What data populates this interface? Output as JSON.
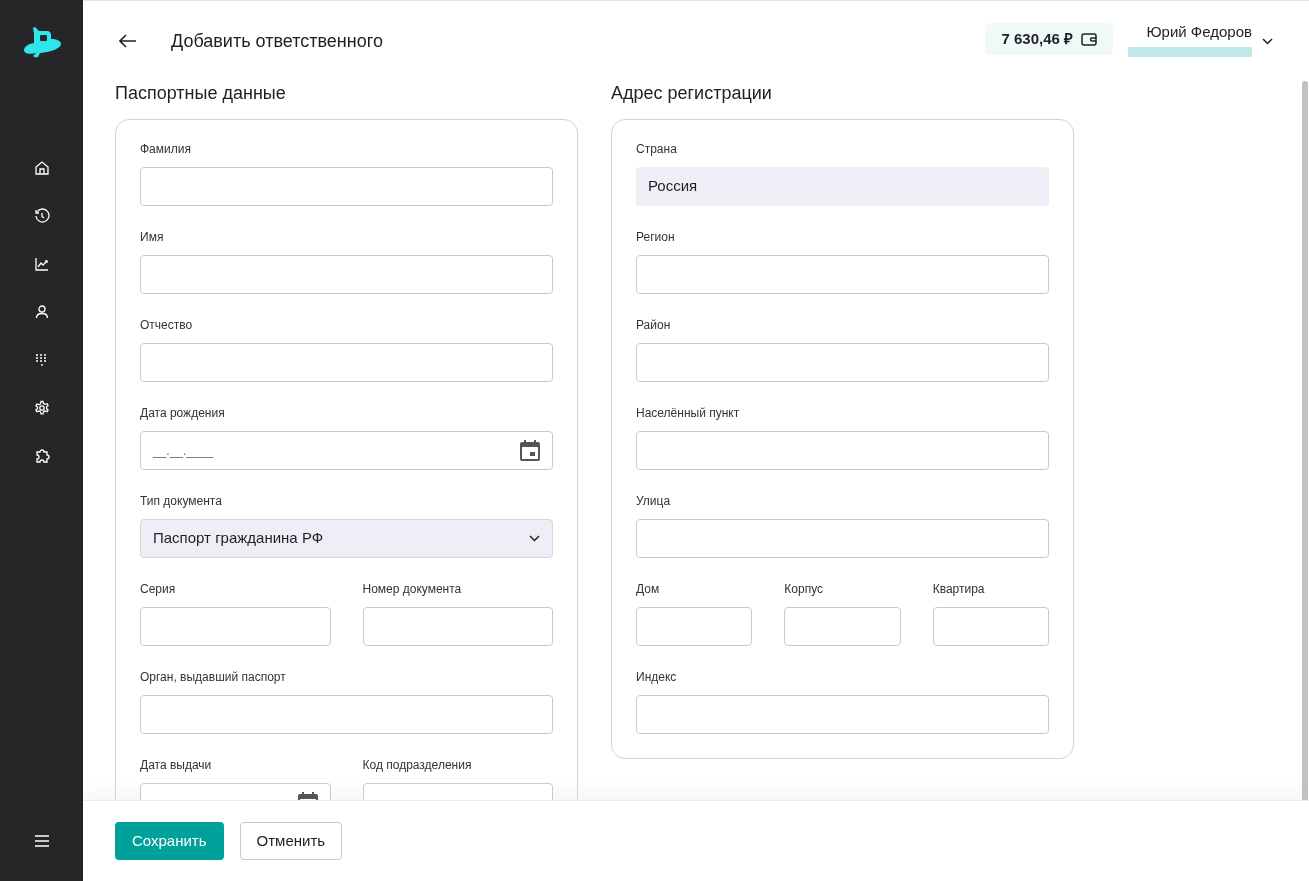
{
  "header": {
    "title": "Добавить ответственного",
    "balance": "7 630,46 ₽",
    "user_name": "Юрий Федоров"
  },
  "sections": [
    {
      "title": "Паспортные данные",
      "rows": [
        [
          {
            "label": "Фамилия",
            "kind": "text"
          }
        ],
        [
          {
            "label": "Имя",
            "kind": "text"
          }
        ],
        [
          {
            "label": "Отчество",
            "kind": "text"
          }
        ],
        [
          {
            "label": "Дата рождения",
            "kind": "date",
            "placeholder": "__.__.____"
          }
        ],
        [
          {
            "label": "Тип документа",
            "kind": "select",
            "value": "Паспорт гражданина РФ"
          }
        ],
        [
          {
            "label": "Серия",
            "kind": "text"
          },
          {
            "label": "Номер документа",
            "kind": "text"
          }
        ],
        [
          {
            "label": "Орган, выдавший паспорт",
            "kind": "text"
          }
        ],
        [
          {
            "label": "Дата выдачи",
            "kind": "date"
          },
          {
            "label": "Код подразделения",
            "kind": "text"
          }
        ]
      ]
    },
    {
      "title": "Адрес регистрации",
      "rows": [
        [
          {
            "label": "Страна",
            "kind": "filled",
            "value": "Россия"
          }
        ],
        [
          {
            "label": "Регион",
            "kind": "text"
          }
        ],
        [
          {
            "label": "Район",
            "kind": "text"
          }
        ],
        [
          {
            "label": "Населённый пункт",
            "kind": "text"
          }
        ],
        [
          {
            "label": "Улица",
            "kind": "text"
          }
        ],
        [
          {
            "label": "Дом",
            "kind": "text"
          },
          {
            "label": "Корпус",
            "kind": "text"
          },
          {
            "label": "Квартира",
            "kind": "text"
          }
        ],
        [
          {
            "label": "Индекс",
            "kind": "text"
          }
        ]
      ]
    }
  ],
  "footer": {
    "buttons": [
      {
        "label": "Сохранить",
        "kind": "primary"
      },
      {
        "label": "Отменить",
        "kind": "secondary"
      }
    ]
  }
}
